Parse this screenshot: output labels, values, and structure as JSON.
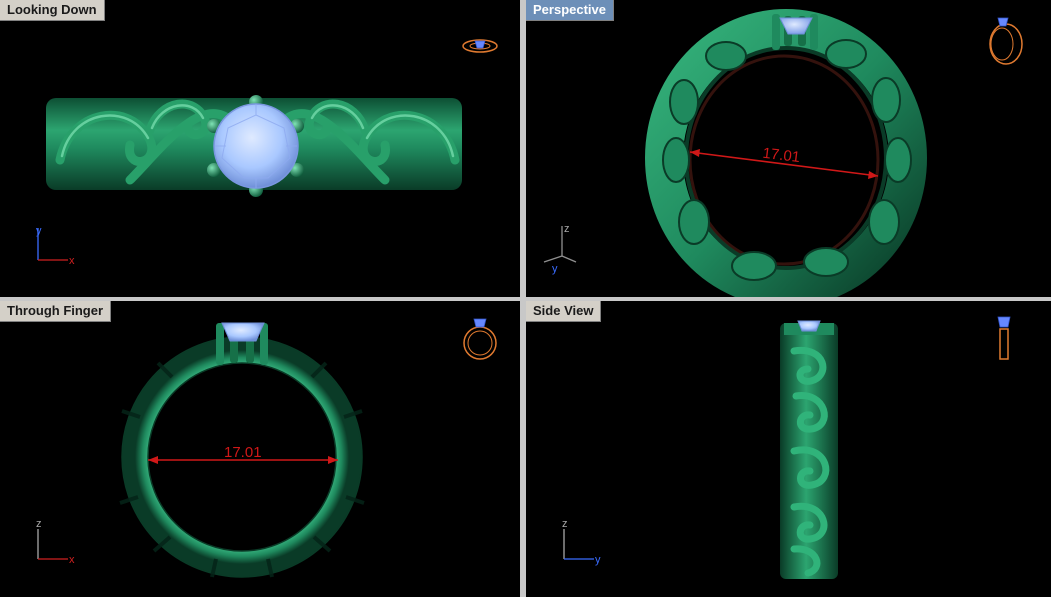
{
  "viewports": [
    {
      "id": "top-left",
      "title": "Looking Down",
      "active": false
    },
    {
      "id": "top-right",
      "title": "Perspective",
      "active": true
    },
    {
      "id": "bottom-left",
      "title": "Through Finger",
      "active": false
    },
    {
      "id": "bottom-right",
      "title": "Side View",
      "active": false
    }
  ],
  "dimensions": {
    "perspective_diameter": "17.01",
    "through_finger_diameter": "17.01"
  },
  "axes": {
    "looking_down": {
      "vertical": "y",
      "horizontal": "x"
    },
    "perspective": {
      "vertical": "z",
      "horizontal": "y"
    },
    "through_finger": {
      "vertical": "z",
      "horizontal": "x"
    },
    "side_view": {
      "vertical": "z",
      "horizontal": "y"
    }
  },
  "colors": {
    "metal": "#1f8a5e",
    "metal_dark": "#0d4f34",
    "metal_light": "#5fd3a0",
    "stone": "#a9c8ff",
    "dimension": "#d01818",
    "viewport_bg": "#000000",
    "divider": "#c8c8c8",
    "active_title": "#6d8fb8"
  }
}
